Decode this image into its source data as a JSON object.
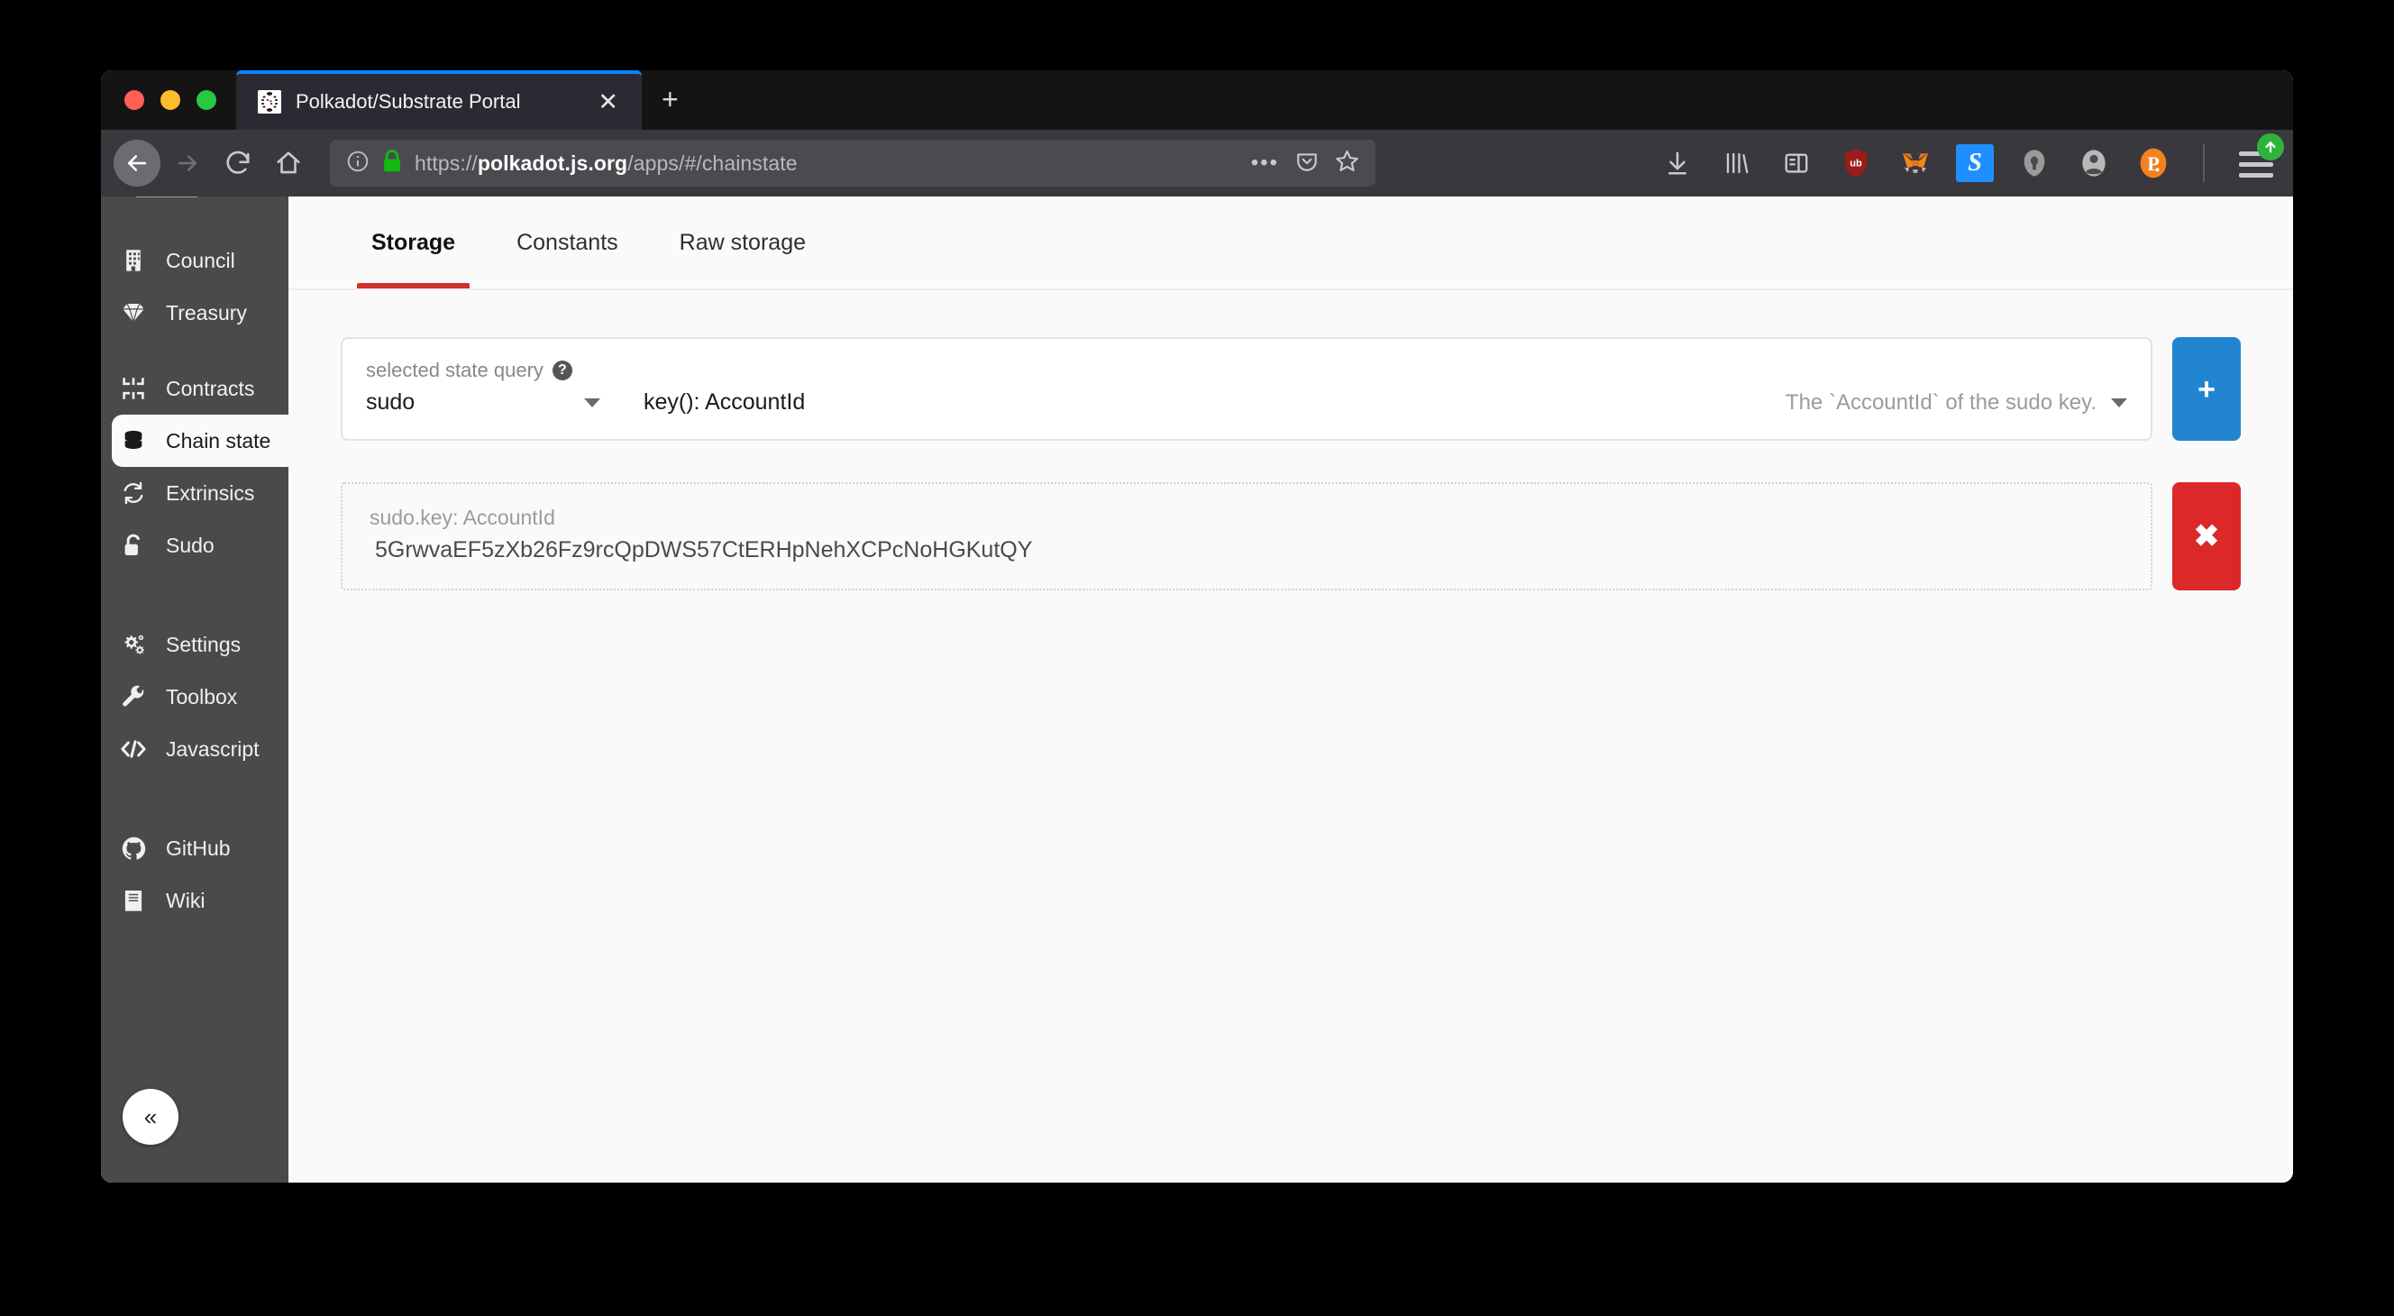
{
  "browser": {
    "tab": {
      "title": "Polkadot/Substrate Portal",
      "favicon": "polkadot-logo-icon",
      "close_label": "✕"
    },
    "new_tab_label": "+",
    "nav": {
      "back_label": "←",
      "forward_label": "→",
      "reload_label": "↻",
      "home_label": "⌂"
    },
    "url": {
      "scheme": "https://",
      "host": "polkadot.js.org",
      "path": "/apps/#/chainstate",
      "full": "https://polkadot.js.org/apps/#/chainstate",
      "info_icon": "info-circle-icon",
      "lock_icon": "padlock-secure-icon",
      "page_actions_label": "•••",
      "pocket_icon": "pocket-icon",
      "bookmark_icon": "star-bookmark-icon"
    },
    "extensions": [
      {
        "name": "downloads-icon",
        "glyph": "↓"
      },
      {
        "name": "library-icon",
        "glyph": "|||\\"
      },
      {
        "name": "sidebar-icon",
        "glyph": "▤"
      },
      {
        "name": "ublock-origin-icon",
        "glyph": "ub",
        "color": "#9b1c1c"
      },
      {
        "name": "metamask-icon",
        "glyph": "🦊",
        "color": "#e8821e"
      },
      {
        "name": "scaffold-icon",
        "glyph": "S",
        "color": "#1f8fff"
      },
      {
        "name": "password-manager-icon",
        "glyph": "●",
        "color": "#9a9a9a"
      },
      {
        "name": "account-icon",
        "glyph": "◯",
        "color": "#b8b8b8"
      },
      {
        "name": "polkadot-extension-icon",
        "glyph": "P",
        "color": "#f48120"
      }
    ],
    "menu": {
      "name": "hamburger-menu",
      "badge": "update-available-arrow"
    }
  },
  "sidebar": {
    "items": [
      {
        "label": "Council",
        "icon": "building-icon",
        "active": false,
        "group": 0
      },
      {
        "label": "Treasury",
        "icon": "gem-icon",
        "active": false,
        "group": 0
      },
      {
        "label": "Contracts",
        "icon": "contract-icon",
        "active": false,
        "group": 1
      },
      {
        "label": "Chain state",
        "icon": "database-icon",
        "active": true,
        "group": 1
      },
      {
        "label": "Extrinsics",
        "icon": "sync-icon",
        "active": false,
        "group": 1
      },
      {
        "label": "Sudo",
        "icon": "unlock-icon",
        "active": false,
        "group": 1
      },
      {
        "label": "Settings",
        "icon": "gears-icon",
        "active": false,
        "group": 2
      },
      {
        "label": "Toolbox",
        "icon": "wrench-icon",
        "active": false,
        "group": 2
      },
      {
        "label": "Javascript",
        "icon": "code-icon",
        "active": false,
        "group": 2
      },
      {
        "label": "GitHub",
        "icon": "github-icon",
        "active": false,
        "group": 3
      },
      {
        "label": "Wiki",
        "icon": "book-icon",
        "active": false,
        "group": 3
      }
    ],
    "collapse_label": "«"
  },
  "main": {
    "tabs": [
      {
        "label": "Storage",
        "active": true
      },
      {
        "label": "Constants",
        "active": false
      },
      {
        "label": "Raw storage",
        "active": false
      }
    ],
    "active_tab_underline_color": "#d0322c",
    "query": {
      "label": "selected state query",
      "help_icon": "question-mark-help-icon",
      "module": "sudo",
      "method": "key(): AccountId",
      "documentation": "The `AccountId` of the sudo key.",
      "add_button_label": "+",
      "add_button_color": "#2185d0"
    },
    "results": [
      {
        "key": "sudo.key: AccountId",
        "value": "5GrwvaEF5zXb26Fz9rcQpDWS57CtERHpNehXCPcNoHGKutQY",
        "remove_button_label": "✖",
        "remove_button_color": "#db2828"
      }
    ]
  }
}
